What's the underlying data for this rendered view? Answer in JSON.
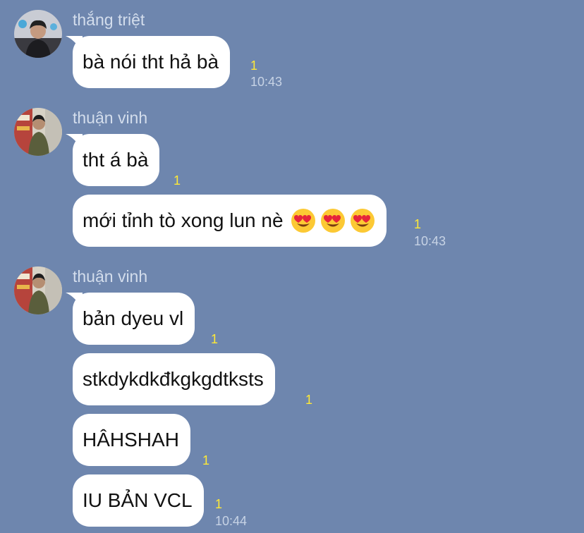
{
  "chat": {
    "groups": [
      {
        "sender": "thắng triệt",
        "avatar_icon": "profile-photo-icon",
        "messages": [
          {
            "text": "bà nói tht hả bà",
            "read_count": "1",
            "time": "10:43"
          }
        ]
      },
      {
        "sender": "thuận vinh",
        "avatar_icon": "profile-photo-icon",
        "messages": [
          {
            "text": "tht á bà",
            "read_count": "1"
          },
          {
            "text": "mới tỉnh tò xong lun nè",
            "emojis": [
              "heart-eyes-emoji",
              "heart-eyes-emoji",
              "heart-eyes-emoji"
            ],
            "read_count": "1",
            "time": "10:43"
          }
        ]
      },
      {
        "sender": "thuận vinh",
        "avatar_icon": "profile-photo-icon",
        "messages": [
          {
            "text": "bản dyeu vl",
            "read_count": "1"
          },
          {
            "text": "stkdykdkđkgkgdtksts",
            "read_count": "1"
          },
          {
            "text": "HÂHSHAH",
            "read_count": "1"
          },
          {
            "text": "IU BẢN VCL",
            "read_count": "1",
            "time": "10:44"
          }
        ]
      }
    ]
  },
  "colors": {
    "background": "#6e86ae",
    "bubble": "#ffffff",
    "read_indicator": "#ffe936",
    "timestamp": "#c7d3e5",
    "sender_name": "#d3ddec"
  }
}
